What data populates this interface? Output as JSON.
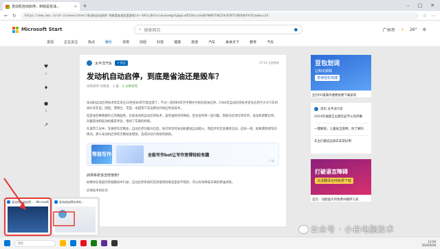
{
  "browser": {
    "tab1_title": "发动机自动启停，到底是省油...",
    "url": "https://www.msn.cn/zh-cn/news/other/发动机自动启停-到底是省油还是毁车/ar-AA1sjOb?ocid=msedgntp&pc=U531&cvid=66f0092746224c078571003d6fdf41aa&ei=14"
  },
  "site": {
    "brand": "Microsoft Start",
    "search_placeholder": "搜索网页",
    "location": "广州市",
    "temperature": "26°",
    "categories": [
      "发现",
      "正在关注",
      "热点",
      "娱乐",
      "体育",
      "财经",
      "科技",
      "健康",
      "旅游",
      "汽车",
      "美食天下",
      "教育",
      "汽车"
    ],
    "active_category": 3
  },
  "sidebar": {
    "like_count": "1",
    "comment_count": "1"
  },
  "article": {
    "source": "太平洋汽车",
    "follow_label": "+ 关注",
    "publish_time": "07:16 天前更新",
    "title": "发动机自动启停，到底是省油还是毁车？",
    "byline": "试驾测评 的频道",
    "views": "1 展",
    "read_time": "2 分钟读完",
    "paragraphs": [
      "发动机自动启停技术其实早在20世纪80年代就出现了，不过一直到80年代中期才开始在欧洲应用，1984年自动启停技术首先应用于大众汽车的高尔夫车型。随后，雪佛兰、丰田、本田等汽车品牌也开始应用该技术。",
      "但是往回事情都有它的两面性，比如发动机自动启停技术，虽然油耗有所降低，但也会带来一些问题。例如在红绿灯停车时，发动机频繁启停，对蓄电池和起动机都是考验，增加了车辆的损耗。",
      "在城市工况中，车辆停车次数多，自动启停功能开启后，每次停车时发动机都会自动熄火，而起步时又会重新启动，这样一来，如果遇到堵车的情况，那么发动机启停的次数就会增加，造成对动力系统的损耗。"
    ],
    "ad_title": "全能写作bot让写作变得轻松有趣",
    "ad_logo": "帮我写作",
    "ad_tag": "广告",
    "subheading": "启停系统该怎样使用？",
    "para_after": "如果你在家庭的常规路段中行驶，自动启停系统的实际使用效果还是很不错的，可以有效降低车辆的燃油消耗。",
    "last_line": "启停技术的优点"
  },
  "right": {
    "ad1_title": "豆包划词",
    "ad1_sub": "让知识获取",
    "ad1_btn": "变得轻松快捷",
    "ad1_caption": "豆包PC版操作便捷免费下载安装",
    "news_source": "资讯 太平洋汽车",
    "news_items": [
      "2024年福建王主题饮品节火热开幕",
      "一键解锁，儿童安全座椅，你了解吗",
      "车主们都说这款车非常好用"
    ],
    "ad2_title": "打破语言障碍",
    "ad2_btn": "沉浸翻译在线免费下载",
    "ad2_caption": "豆包 - 功能强大的免费AI翻译工具"
  },
  "taskbar": {
    "search_placeholder": "搜索",
    "time": "13:59",
    "date": "2024/9/28",
    "preview1": "发动机自动启停... - Microsoft",
    "preview2": "发动机启停技术的..."
  },
  "watermark": "公众号 · 小白电脑技术"
}
